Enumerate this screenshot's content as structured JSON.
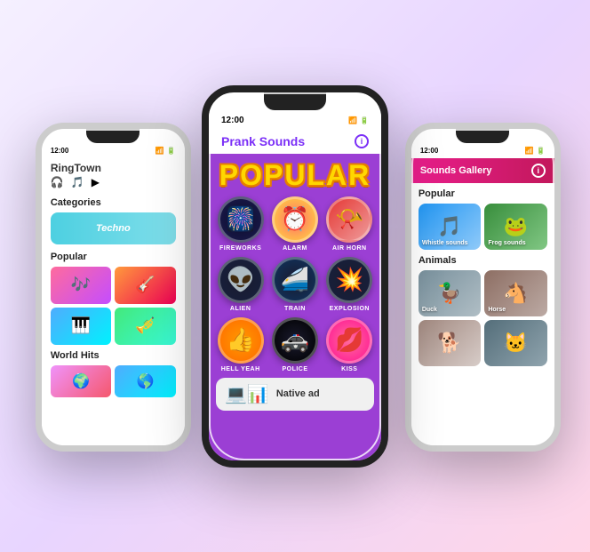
{
  "left_phone": {
    "status_time": "12:00",
    "status_icons": "▲ ◀ ▮▮▮",
    "app_name": "RingTown",
    "icons": [
      "🎧",
      "🎵",
      "▶"
    ],
    "sections": {
      "categories": "Categories",
      "categories_banner": "Techno",
      "popular": "Popular",
      "world_hits": "World Hits"
    }
  },
  "center_phone": {
    "status_time": "12:00",
    "status_icons": "▲ ◀ ▮▮▮",
    "app_name": "Prank Sounds",
    "info_icon": "i",
    "popular_label": "POPULAR",
    "sounds": [
      {
        "name": "FIREWORKS",
        "emoji": "🎆",
        "circle_class": "circle-fireworks"
      },
      {
        "name": "ALARM",
        "emoji": "⏰",
        "circle_class": "circle-alarm"
      },
      {
        "name": "AIR HORN",
        "emoji": "📯",
        "circle_class": "circle-airhorn"
      },
      {
        "name": "ALIEN",
        "emoji": "👽",
        "circle_class": "circle-alien"
      },
      {
        "name": "TRAIN",
        "emoji": "🚄",
        "circle_class": "circle-train"
      },
      {
        "name": "EXPLOSION",
        "emoji": "💥",
        "circle_class": "circle-explosion"
      },
      {
        "name": "HELL YEAH",
        "emoji": "👍",
        "circle_class": "circle-hellyeah"
      },
      {
        "name": "POLICE",
        "emoji": "🚓",
        "circle_class": "circle-police"
      },
      {
        "name": "KISS",
        "emoji": "💋",
        "circle_class": "circle-kiss"
      }
    ],
    "native_ad": "Native ad"
  },
  "right_phone": {
    "status_time": "12:00",
    "status_icons": "▲ ◀ ▮▮▮",
    "app_name": "Sounds Gallery",
    "info_icon": "i",
    "sections": {
      "popular": "Popular",
      "animals": "Animals"
    },
    "popular_items": [
      {
        "label": "Whistle sounds",
        "emoji": "🎵"
      },
      {
        "label": "Frog sounds",
        "emoji": "🐸"
      }
    ],
    "animal_items": [
      {
        "label": "Duck",
        "emoji": "🦆"
      },
      {
        "label": "Horse",
        "emoji": "🐴"
      },
      {
        "label": "",
        "emoji": "🐕"
      },
      {
        "label": "",
        "emoji": "🐱"
      }
    ]
  }
}
